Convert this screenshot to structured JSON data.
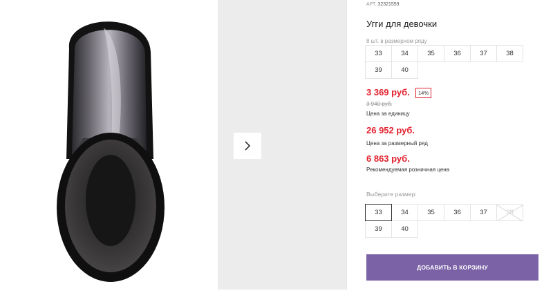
{
  "product": {
    "article_label": "АРТ.",
    "article_number": "32321559",
    "title": "Угги для девочки"
  },
  "size_run": {
    "note": "8 шт. в размерном ряду",
    "sizes": [
      "33",
      "34",
      "35",
      "36",
      "37",
      "38",
      "39",
      "40"
    ]
  },
  "pricing": {
    "unit_price": "3 369 руб.",
    "discount": "14%",
    "old_price": "3 940 руб.",
    "unit_price_label": "Цена за единицу",
    "run_price": "26 952 руб.",
    "run_price_label": "Цена за размерный ряд",
    "retail_price": "6 863 руб.",
    "retail_price_label": "Рекомендуемая розничная цена",
    "accent_color": "#e3222f"
  },
  "size_select": {
    "label": "Выберите размер:",
    "sizes": [
      "33",
      "34",
      "35",
      "36",
      "37",
      "38",
      "39",
      "40"
    ],
    "selected": "33",
    "unavailable": [
      "38"
    ]
  },
  "cart": {
    "button_label": "ДОБАВИТЬ В КОРЗИНУ",
    "button_color": "#7b62a6"
  },
  "gallery": {
    "image_subject": "ugg-boot-metallic",
    "next_icon": "chevron-right-icon"
  }
}
